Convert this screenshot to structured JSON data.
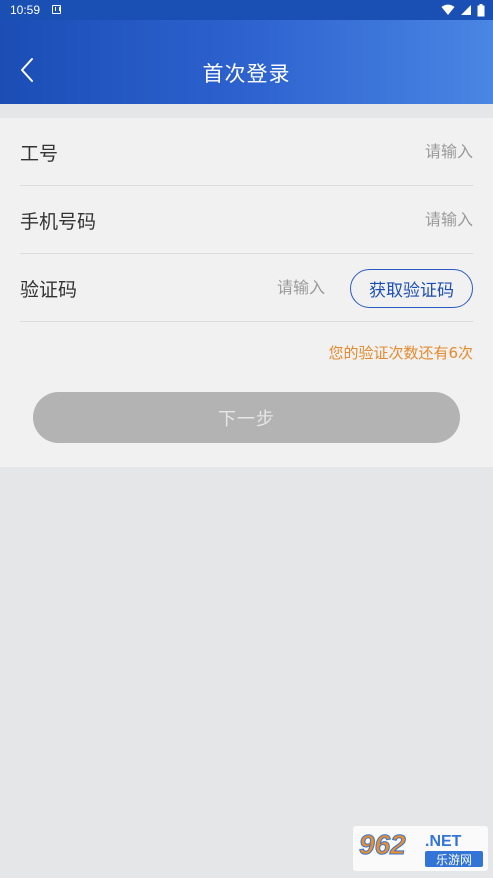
{
  "status_bar": {
    "time": "10:59",
    "icons": [
      "notification-icon",
      "wifi-icon",
      "signal-icon",
      "battery-icon"
    ]
  },
  "header": {
    "title": "首次登录",
    "back_icon": "chevron-left-icon"
  },
  "form": {
    "employee_id": {
      "label": "工号",
      "placeholder": "请输入",
      "value": ""
    },
    "phone": {
      "label": "手机号码",
      "placeholder": "请输入",
      "value": ""
    },
    "code": {
      "label": "验证码",
      "placeholder": "请输入",
      "value": "",
      "button_label": "获取验证码"
    },
    "remaining_hint": "您的验证次数还有6次",
    "next_label": "下一步"
  },
  "watermark": {
    "brand": "962",
    "suffix": ".NET",
    "subtitle": "乐游网"
  },
  "colors": {
    "header_start": "#1b4db5",
    "header_end": "#4a86e3",
    "accent": "#2a5bc4",
    "hint": "#e58a2c",
    "disabled_button": "#b3b3b4"
  }
}
